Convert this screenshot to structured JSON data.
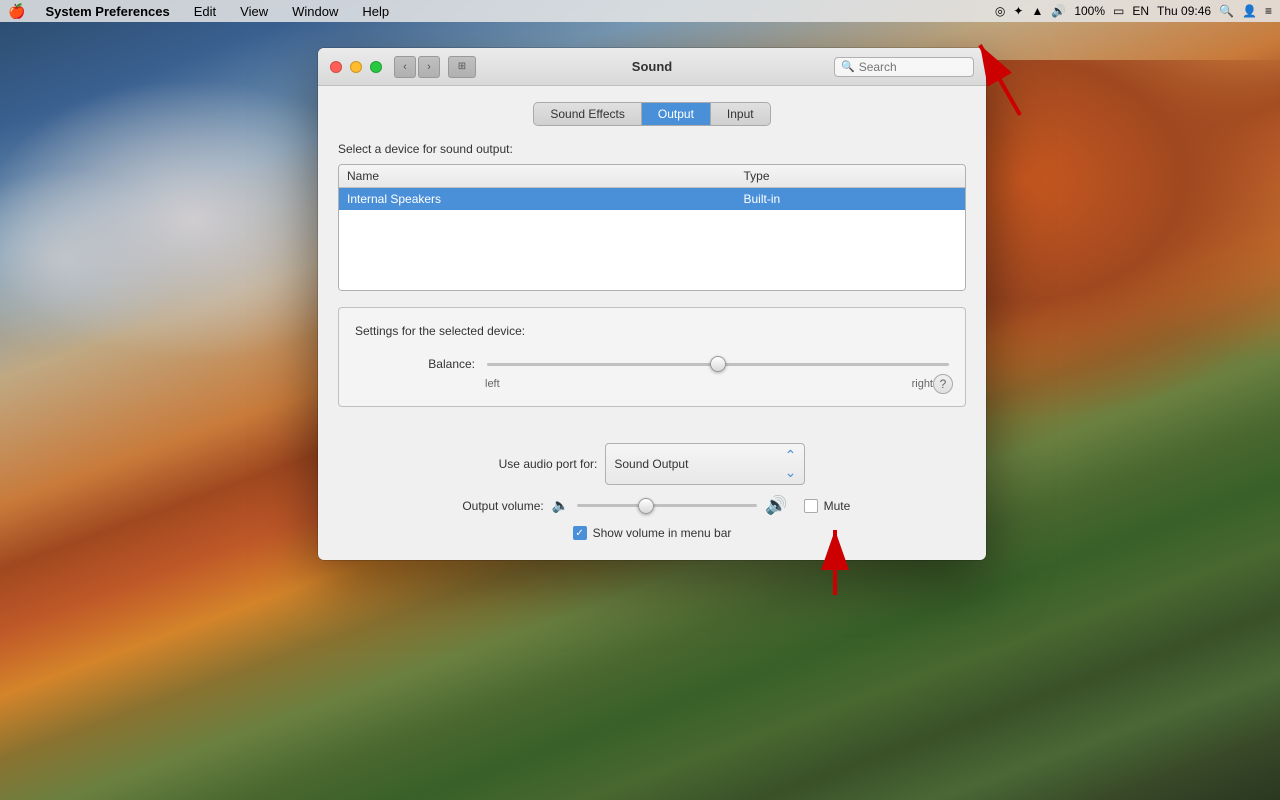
{
  "menubar": {
    "apple": "🍎",
    "items": [
      "System Preferences",
      "Edit",
      "View",
      "Window",
      "Help"
    ],
    "right": {
      "time": "Thu 09:46",
      "battery": "100%",
      "volume_icon": "🔊",
      "wifi_icon": "wifi",
      "bluetooth_icon": "bt"
    }
  },
  "window": {
    "title": "Sound",
    "search_placeholder": "Search",
    "tabs": [
      "Sound Effects",
      "Output",
      "Input"
    ],
    "active_tab": "Output",
    "section_label": "Select a device for sound output:",
    "table": {
      "headers": [
        "Name",
        "Type"
      ],
      "rows": [
        {
          "name": "Internal Speakers",
          "type": "Built-in",
          "selected": true
        }
      ]
    },
    "settings": {
      "label": "Settings for the selected device:",
      "balance_label": "Balance:",
      "left_label": "left",
      "right_label": "right"
    },
    "audio_port": {
      "label": "Use audio port for:",
      "value": "Sound Output"
    },
    "volume": {
      "label": "Output volume:",
      "mute_label": "Mute",
      "mute_checked": false,
      "show_volume_label": "Show volume in menu bar",
      "show_volume_checked": true
    }
  }
}
